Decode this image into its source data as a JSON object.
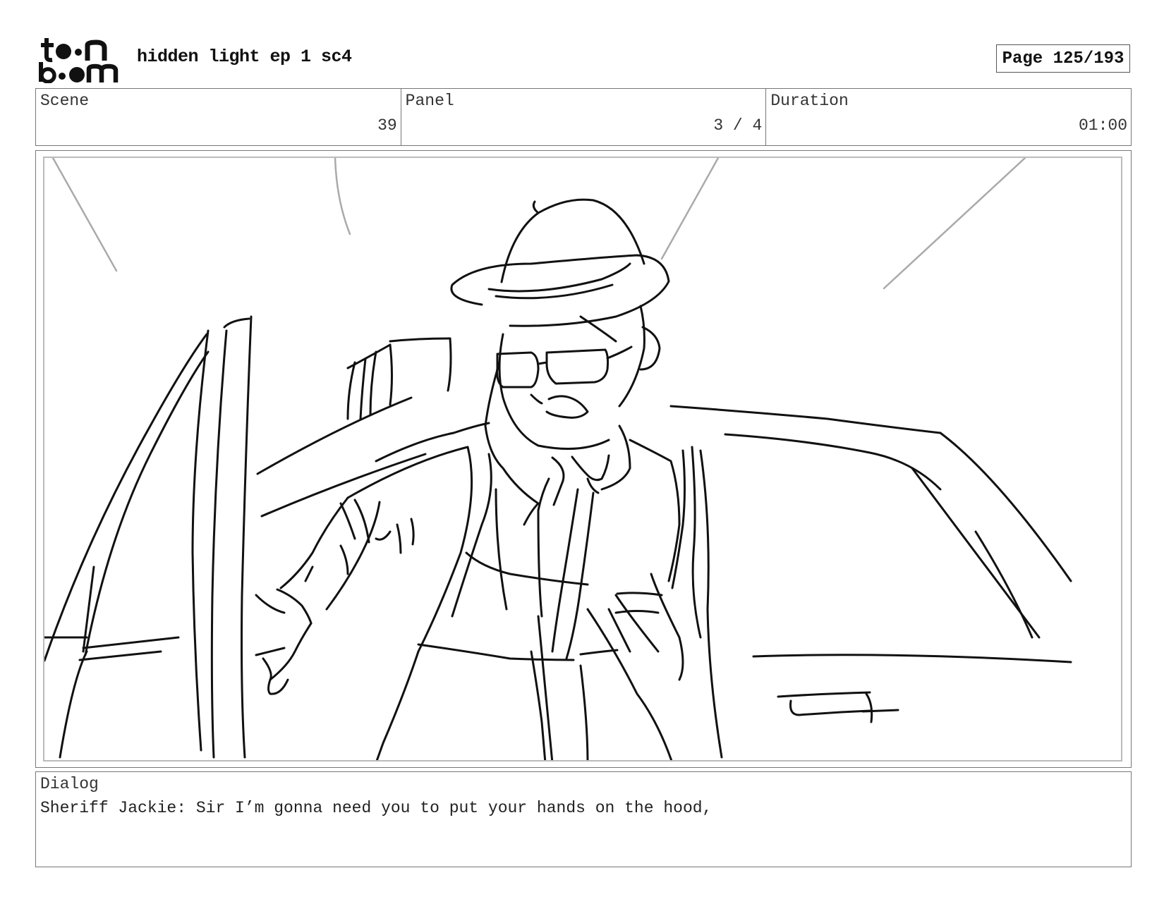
{
  "header": {
    "logo_text": "toon boom",
    "project_title": "hidden light ep 1 sc4",
    "page_indicator": "Page 125/193"
  },
  "info": {
    "scene_label": "Scene",
    "scene_value": "39",
    "panel_label": "Panel",
    "panel_value": "3 / 4",
    "duration_label": "Duration",
    "duration_value": "01:00"
  },
  "panel": {
    "image_icon": "storyboard-sketch-icon"
  },
  "dialog": {
    "label": "Dialog",
    "text": "Sheriff Jackie: Sir I’m gonna need you to put your hands on the hood,"
  }
}
